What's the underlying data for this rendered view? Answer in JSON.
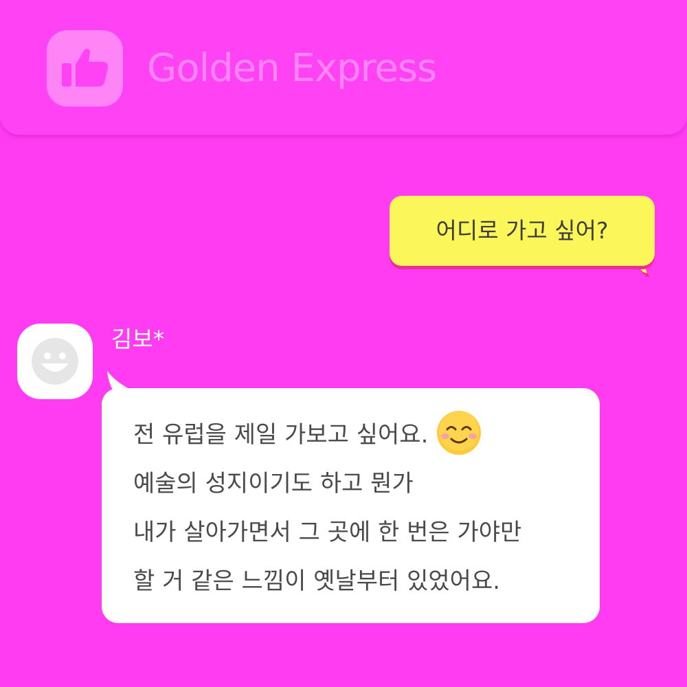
{
  "header": {
    "title": "Golden Express",
    "icon": "thumbs-up-icon"
  },
  "colors": {
    "background": "#ff3cf2",
    "header_text": "#ff85f6",
    "outgoing_bubble": "#fbf65a",
    "incoming_bubble": "#ffffff"
  },
  "messages": {
    "outgoing": {
      "text": "어디로 가고 싶어?"
    },
    "incoming": {
      "sender": "김보*",
      "avatar_icon": "smiling-face-avatar-icon",
      "lines": [
        "전 유럽을 제일 가보고 싶어요.",
        "예술의 성지이기도 하고 뭔가",
        "내가 살아가면서 그 곳에 한 번은 가야만",
        "할 거 같은 느낌이 옛날부터 있었어요."
      ],
      "emoji": "smiling-face-emoji"
    }
  }
}
